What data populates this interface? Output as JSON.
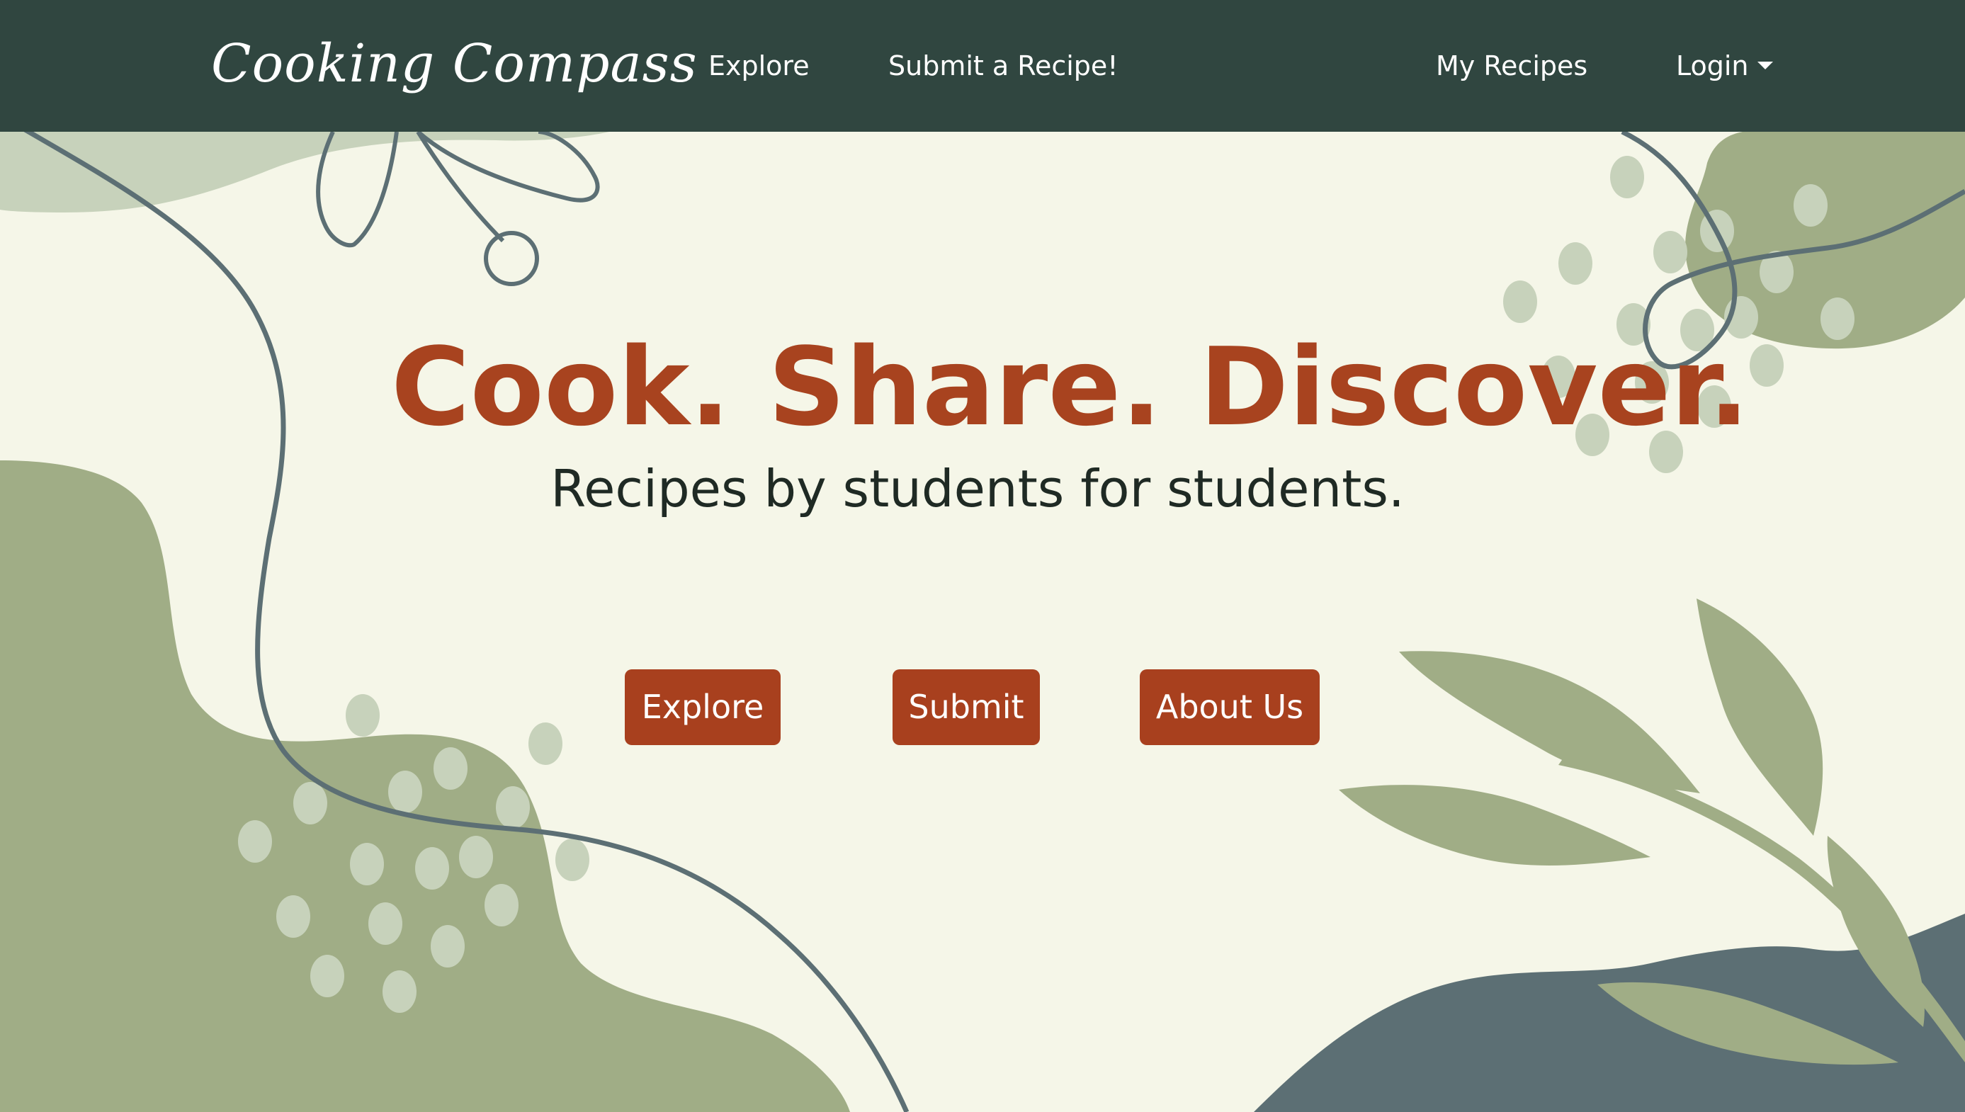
{
  "navbar": {
    "brand": "Cooking Compass",
    "links": {
      "explore": "Explore",
      "submit": "Submit a Recipe!",
      "my_recipes": "My Recipes",
      "login": "Login"
    }
  },
  "hero": {
    "title": "Cook. Share. Discover.",
    "subtitle": "Recipes by students for students.",
    "buttons": {
      "explore": "Explore",
      "submit": "Submit",
      "about": "About Us"
    }
  },
  "colors": {
    "navbar_bg": "#304640",
    "page_bg": "#f5f6e8",
    "accent": "#a8431f",
    "sage_green": "#a0ad86",
    "pale_green": "#c7d2bb",
    "slate_blue": "#5c6f74"
  },
  "icons": {
    "login_caret": "caret-down-icon"
  }
}
